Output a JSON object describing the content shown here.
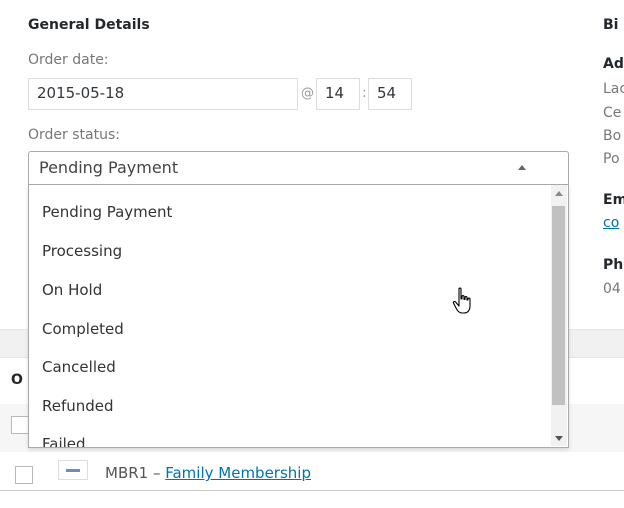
{
  "general": {
    "title": "General Details",
    "order_date_label": "Order date:",
    "order_date": "2015-05-18",
    "at": "@",
    "hour": "14",
    "colon": ":",
    "minute": "54",
    "status_label": "Order status:",
    "status_selected": "Pending Payment",
    "status_options": [
      "Pending Payment",
      "Processing",
      "On Hold",
      "Completed",
      "Cancelled",
      "Refunded",
      "Failed"
    ]
  },
  "billing": {
    "title": "Bi",
    "address_label": "Ad",
    "address_lines": [
      "Lac",
      "Ce",
      "Bo",
      "Po"
    ],
    "email_label": "Em",
    "email_link": "co",
    "phone_label": "Ph",
    "phone": "04"
  },
  "items": {
    "col_header": "O",
    "row_text": "MBR1 – ",
    "row_link": "Family Membership"
  }
}
